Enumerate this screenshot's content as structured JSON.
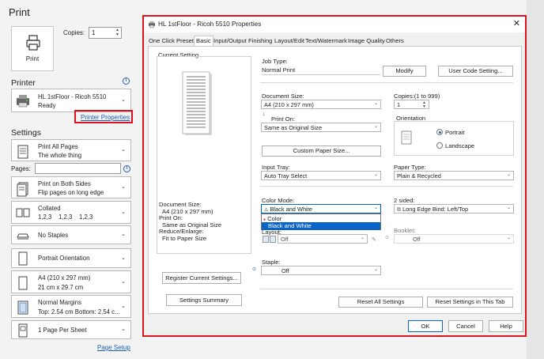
{
  "print_panel": {
    "title": "Print",
    "print_button_label": "Print",
    "copies_label": "Copies:",
    "copies_value": "1",
    "printer_heading": "Printer",
    "printer_name": "HL 1stFloor - Ricoh 5510",
    "printer_status": "Ready",
    "printer_properties_link": "Printer Properties",
    "settings_heading": "Settings",
    "print_range_main": "Print All Pages",
    "print_range_sub": "The whole thing",
    "pages_label": "Pages:",
    "sides_main": "Print on Both Sides",
    "sides_sub": "Flip pages on long edge",
    "collate_main": "Collated",
    "collate_sub": "1,2,3    1,2,3    1,2,3",
    "staple": "No Staples",
    "orientation": "Portrait Orientation",
    "paper_main": "A4 (210 x 297 mm)",
    "paper_sub": "21 cm x 29.7 cm",
    "margins_main": "Normal Margins",
    "margins_sub": "Top: 2.54 cm Bottom: 2.54 c...",
    "pages_per_sheet": "1 Page Per Sheet",
    "page_setup_link": "Page Setup"
  },
  "dialog": {
    "title": "HL 1stFloor - Ricoh 5510 Properties",
    "tabs": [
      "One Click Presets",
      "Basic",
      "Input/Output",
      "Finishing",
      "Layout/Edit",
      "Text/Watermark",
      "Image Quality",
      "Others"
    ],
    "current_setting_label": "Current Setting",
    "summary": {
      "doc_size_label": "Document Size:",
      "doc_size_value": "A4 (210 x 297 mm)",
      "print_on_label": "Print On:",
      "print_on_value": "Same as Original Size",
      "reduce_label": "Reduce/Enlarge:",
      "reduce_value": "Fit to Paper Size"
    },
    "register_button": "Register Current Settings...",
    "summary_button": "Settings Summary",
    "job_type_label": "Job Type:",
    "job_type_value": "Normal Print",
    "modify_button": "Modify",
    "user_code_button": "User Code Setting...",
    "document_size_label": "Document Size:",
    "document_size_value": "A4 (210 x 297 mm)",
    "copies_label": "Copies:(1 to 999)",
    "copies_value": "1",
    "print_on_label": "Print On:",
    "print_on_value": "Same as Original Size",
    "orientation_label": "Orientation",
    "portrait_label": "Portrait",
    "landscape_label": "Landscape",
    "custom_paper_button": "Custom Paper Size...",
    "input_tray_label": "Input Tray:",
    "input_tray_value": "Auto Tray Select",
    "paper_type_label": "Paper Type:",
    "paper_type_value": "Plain & Recycled",
    "color_mode_label": "Color Mode:",
    "color_mode_value": "Black and White",
    "color_options": [
      "Color",
      "Black and White"
    ],
    "two_sided_label": "2 sided:",
    "two_sided_value": "Long Edge Bind: Left/Top",
    "layout_label": "Layout:",
    "layout_value": "Off",
    "booklet_label": "Booklet:",
    "booklet_value": "Off",
    "staple_label": "Staple:",
    "staple_value": "Off",
    "reset_all_button": "Reset All Settings",
    "reset_tab_button": "Reset Settings in This Tab",
    "ok_button": "OK",
    "cancel_button": "Cancel",
    "help_button": "Help"
  },
  "colors": {
    "highlight_red": "#d9141f",
    "link_blue": "#1a5fb4",
    "selection_blue": "#0a64c8"
  }
}
